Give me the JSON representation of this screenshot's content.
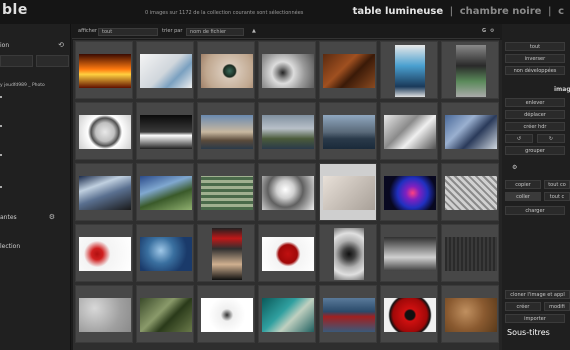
{
  "app": {
    "logo": "ble"
  },
  "header": {
    "status": "0 images sur 1172 de la collection courante sont sélectionnées",
    "views": {
      "active": "table lumineuse",
      "sep": "|",
      "second": "chambre noire",
      "third": "c"
    }
  },
  "left_panel": {
    "collection_title": "ion",
    "collection_path": "y jeudfd989 _ Photo",
    "tags_title": "antes",
    "collection2_title": "lection"
  },
  "filter_bar": {
    "afficher_label": "afficher",
    "afficher_value": "tout",
    "trier_label": "trier par",
    "trier_value": "nom de fichier",
    "sort_arrow": "▲",
    "g_label": "G"
  },
  "right_panel": {
    "select_all": "tout",
    "invert": "inverser",
    "not_developed": "non développées",
    "images_title": "imag",
    "remove": "enlever",
    "move": "déplacer",
    "create_hdr": "créer hdr",
    "group": "grouper",
    "copy": "copier",
    "copy_all": "tout co",
    "paste": "coller",
    "paste_all": "tout c",
    "load": "charger",
    "color_note": "cloner l'image et appl",
    "create": "créer",
    "modify": "modifi",
    "import": "importer"
  },
  "caption": "Sous-titres",
  "thumbnails": [
    {
      "name": "fire",
      "bg": "linear-gradient(180deg,#3a0a00,#ff7a10 45%,#ffd040 60%,#601000)"
    },
    {
      "name": "paper-curl",
      "bg": "linear-gradient(135deg,#f4f4f4,#d0d6dc 50%,#7aa0c0 70%,#f0f0f0)"
    },
    {
      "name": "eye",
      "bg": "radial-gradient(circle at 55% 50%,#3a6a5a 0,#1a2a20 18%,#d8c8b8 22%,#c0a890 70%,#a08068)"
    },
    {
      "name": "eye-sketch",
      "bg": "radial-gradient(circle at 40% 55%,#222 0,#888 15%,#ddd 30%,#999 60%,#555)"
    },
    {
      "name": "chain",
      "bg": "linear-gradient(135deg,#5a2a10,#a05020 40%,#3a1a08 60%,#8a4a20)"
    },
    {
      "name": "phone",
      "bg": "linear-gradient(180deg,#e8e8e8,#4aa0d0 40%,#1a3a5a 80%,#e0e0e0)",
      "tall": true
    },
    {
      "name": "mobile-device",
      "bg": "linear-gradient(180deg,#8a8a8a,#2a2a2a 40%,#5a8a5a 70%,#aaaaaa)",
      "tall": true
    },
    {
      "name": "gimp-logo",
      "bg": "radial-gradient(circle,#e8e8e8 0,#c0c0c0 30%,#505050 45%,#ffffff 55%,#cfcfcf)"
    },
    {
      "name": "road-dark",
      "bg": "linear-gradient(180deg,#0a0a0a,#3a3a3a 50%,#ffffff 60%,#202020)"
    },
    {
      "name": "landscape",
      "bg": "linear-gradient(180deg,#6a8ab0,#c8b8a0 50%,#5a4a3a 75%,#2a3a4a)"
    },
    {
      "name": "river",
      "bg": "linear-gradient(180deg,#8090a0,#b8c0c8 40%,#4a5a3a 70%,#2a3a4a)"
    },
    {
      "name": "pier",
      "bg": "linear-gradient(180deg,#90a8c0,#5a6a7a 50%,#2a3a4a 70%,#1a2a3a)"
    },
    {
      "name": "sketch-car",
      "bg": "linear-gradient(135deg,#e8e8e8,#8a8a8a 40%,#f0f0f0 60%,#505050)"
    },
    {
      "name": "skateboarder",
      "bg": "linear-gradient(135deg,#4a6a9a,#9ab0d0 35%,#2a3a5a 60%,#d0d8e0)"
    },
    {
      "name": "skater-jump",
      "bg": "linear-gradient(160deg,#1a2a4a,#c0d0e0 30%,#5a7090 55%,#1a1a1a)"
    },
    {
      "name": "fantasy-city",
      "bg": "linear-gradient(160deg,#2a4a8a,#80a8d0 35%,#3a5a2a 60%,#90b070)"
    },
    {
      "name": "stairs",
      "bg": "repeating-linear-gradient(0deg,#4a6a4a 0 3px,#a0b090 3px 6px)"
    },
    {
      "name": "bw-portrait",
      "bg": "radial-gradient(circle at 45% 40%,#ffffff 0,#d0d0d0 25%,#606060 50%,#f0f0f0)"
    },
    {
      "name": "map-lines",
      "bg": "linear-gradient(135deg,#e8e0d8,#c8c0b8 50%,#a8a098)"
    },
    {
      "name": "nebula",
      "bg": "radial-gradient(circle at 55% 50%,#ff4080 0,#8020c0 20%,#2030c0 45%,#080820 70%)"
    },
    {
      "name": "metal-plate",
      "bg": "repeating-linear-gradient(45deg,#8a8a8a 0 2px,#d0d0d0 2px 5px)"
    },
    {
      "name": "blood-splatter",
      "bg": "radial-gradient(circle at 35% 50%,#b01010 0,#d02020 15%,#f4f4f4 35%,#ffffff)"
    },
    {
      "name": "water-drops",
      "bg": "radial-gradient(circle at 40% 40%,#a0c8e8 0,#3a70a0 35%,#1a3a6a 70%)"
    },
    {
      "name": "portrait-magazine",
      "bg": "linear-gradient(180deg,#202020,#c01818 20%,#303030 40%,#d0b090 70%,#101010)",
      "tall": true
    },
    {
      "name": "red-splash",
      "bg": "radial-gradient(circle at 50% 50%,#c01010 0,#a00808 30%,#f4f4f4 40%,#ffffff)"
    },
    {
      "name": "bw-eye",
      "bg": "radial-gradient(circle at 50% 50%,#101010 0,#404040 20%,#b0b0b0 45%,#e0e0e0 70%,#707070)",
      "tall": true
    },
    {
      "name": "hands",
      "bg": "linear-gradient(180deg,#303030,#9a9a9a 40%,#d0d0d0 60%,#404040)"
    },
    {
      "name": "dark-texture",
      "bg": "repeating-linear-gradient(90deg,#2a2a2a 0 2px,#3a3a3a 2px 4px)"
    },
    {
      "name": "concrete",
      "bg": "radial-gradient(circle at 30% 30%,#d8d8d8,#a0a0a0 60%,#8a8a8a)"
    },
    {
      "name": "circuit",
      "bg": "linear-gradient(135deg,#3a4a2a,#8a9a6a 40%,#2a3a1a 60%,#6a7a4a)"
    },
    {
      "name": "white-sketch",
      "bg": "radial-gradient(circle at 50% 50%,#303030 0,#f0f0f0 20%,#ffffff 60%)"
    },
    {
      "name": "teal-art",
      "bg": "linear-gradient(135deg,#0a5a5a,#30a0a0 40%,#c0d0c0 60%,#206060)"
    },
    {
      "name": "boat",
      "bg": "linear-gradient(180deg,#5a7a9a,#2a4a6a 40%,#a02020 55%,#3a5a7a)"
    },
    {
      "name": "sharingan",
      "bg": "radial-gradient(circle,#101010 0,#101010 15%,#d01010 20%,#a00808 55%,#101010 65%,#f0f0f0 70%)",
      "tall": false
    },
    {
      "name": "rust-texture",
      "bg": "radial-gradient(circle at 40% 40%,#c09060,#8a5a30 50%,#5a3a1a)"
    }
  ]
}
